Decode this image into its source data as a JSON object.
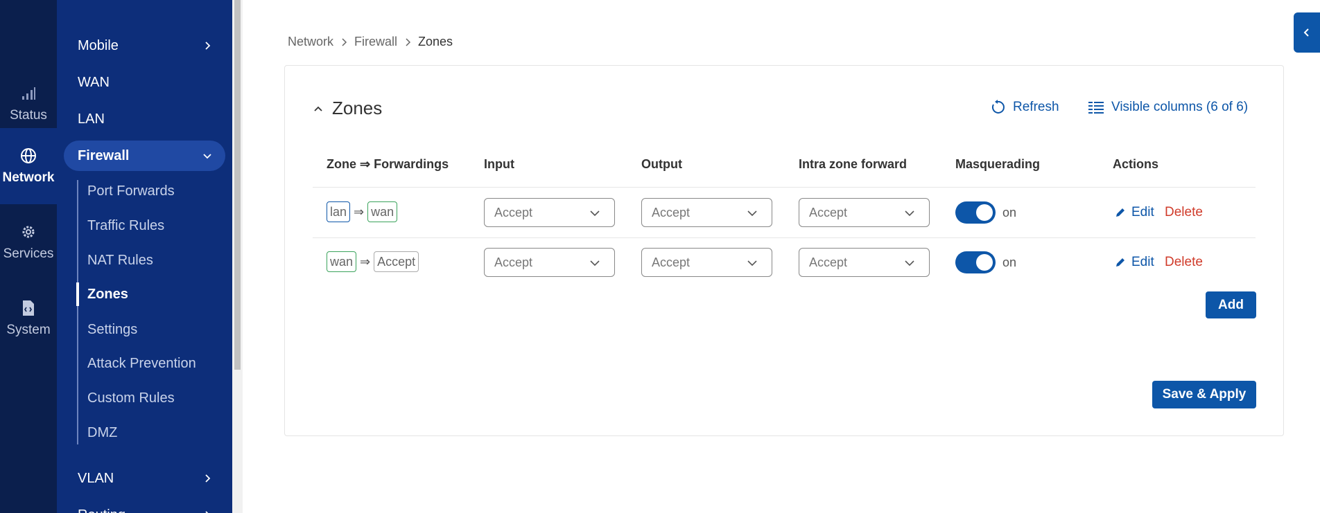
{
  "rail": {
    "items": [
      {
        "label": "Status",
        "icon": "signal-bars-icon"
      },
      {
        "label": "Network",
        "icon": "globe-icon"
      },
      {
        "label": "Services",
        "icon": "gear-icon"
      },
      {
        "label": "System",
        "icon": "file-code-icon"
      }
    ]
  },
  "sidebar": {
    "items": [
      {
        "label": "Mobile"
      },
      {
        "label": "WAN"
      },
      {
        "label": "LAN"
      },
      {
        "label": "Firewall"
      },
      {
        "label": "VLAN"
      },
      {
        "label": "Routing"
      }
    ],
    "firewall_sub": [
      {
        "label": "Port Forwards"
      },
      {
        "label": "Traffic Rules"
      },
      {
        "label": "NAT Rules"
      },
      {
        "label": "Zones"
      },
      {
        "label": "Settings"
      },
      {
        "label": "Attack Prevention"
      },
      {
        "label": "Custom Rules"
      },
      {
        "label": "DMZ"
      }
    ]
  },
  "breadcrumb": [
    "Network",
    "Firewall",
    "Zones"
  ],
  "card": {
    "title": "Zones",
    "refresh_label": "Refresh",
    "columns_label": "Visible columns (6 of 6)"
  },
  "table": {
    "headers": [
      "Zone ⇒ Forwardings",
      "Input",
      "Output",
      "Intra zone forward",
      "Masquerading",
      "Actions"
    ],
    "arrow": "⇒",
    "rows": [
      {
        "zone": "lan",
        "forward": "wan",
        "input": "Accept",
        "output": "Accept",
        "intra": "Accept",
        "masq": "on",
        "edit": "Edit",
        "delete": "Delete"
      },
      {
        "zone": "wan",
        "forward": "Accept",
        "input": "Accept",
        "output": "Accept",
        "intra": "Accept",
        "masq": "on",
        "edit": "Edit",
        "delete": "Delete"
      }
    ]
  },
  "buttons": {
    "add": "Add",
    "save_apply": "Save & Apply"
  },
  "colors": {
    "primary": "#0d56a8",
    "sidebar": "#0d2e7a",
    "rail": "#0b1f4d",
    "danger": "#d03b2a"
  }
}
